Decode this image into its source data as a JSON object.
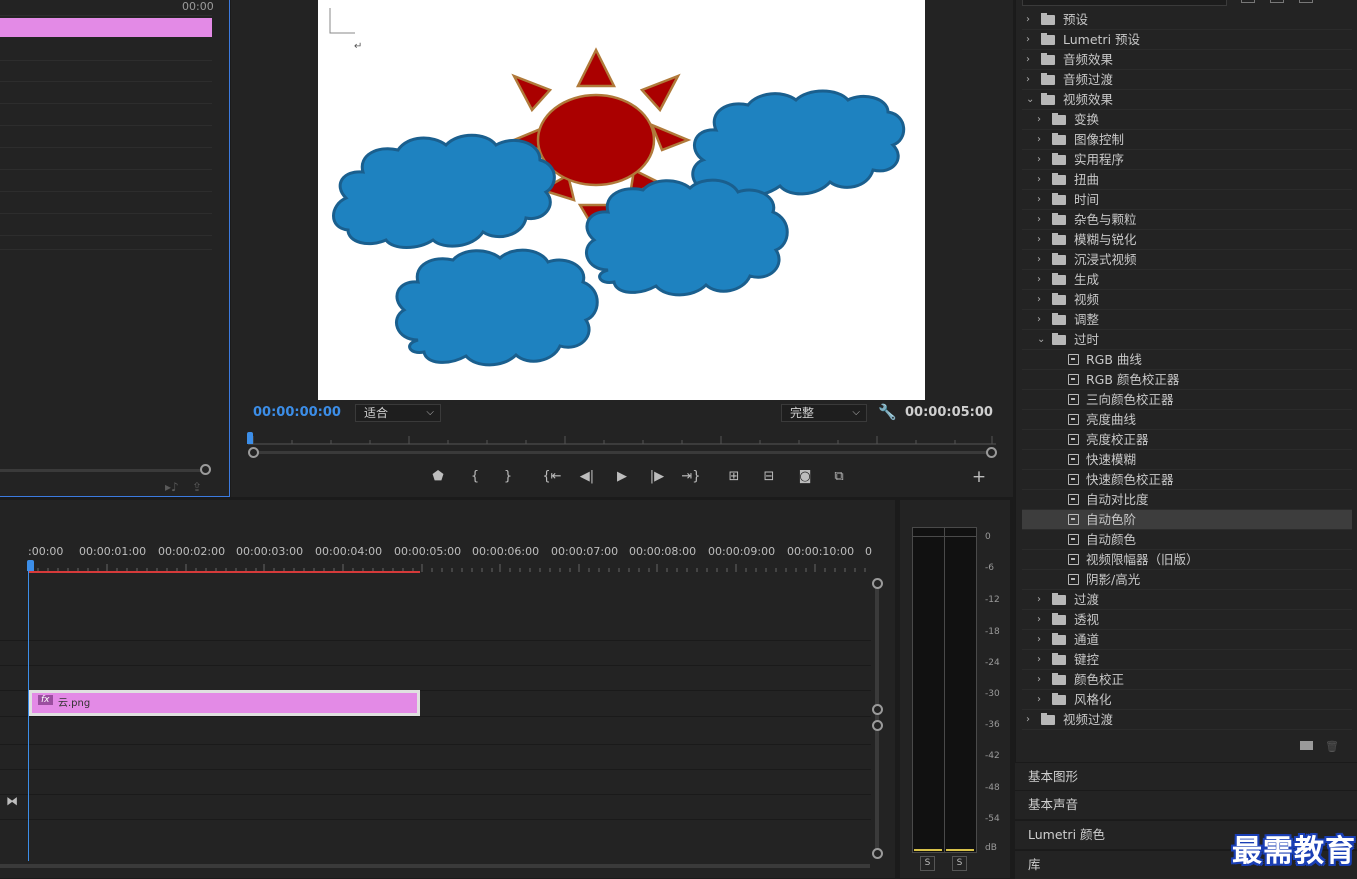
{
  "source": {
    "time": "00:00"
  },
  "program": {
    "current_time": "00:00:00:00",
    "fit": "适合",
    "quality": "完整",
    "duration": "00:00:05:00"
  },
  "transport": {
    "buttons": [
      "marker-icon",
      "mark-in-icon",
      "mark-out-icon",
      "go-to-in-icon",
      "step-back-icon",
      "play-icon",
      "step-forward-icon",
      "go-to-out-icon",
      "lift-icon",
      "extract-icon",
      "export-frame-icon",
      "comparison-view-icon",
      "add-button-icon"
    ]
  },
  "timeline": {
    "ticks": [
      ":00:00",
      "00:00:01:00",
      "00:00:02:00",
      "00:00:03:00",
      "00:00:04:00",
      "00:00:05:00",
      "00:00:06:00",
      "00:00:07:00",
      "00:00:08:00",
      "00:00:09:00",
      "00:00:10:00",
      "0"
    ],
    "clip": {
      "fx": "fx",
      "name": "云.png"
    },
    "clip_color": "#e38ae6",
    "playhead_color": "#3c8ee8"
  },
  "meter": {
    "db_labels": [
      "0",
      "-6",
      "-12",
      "-18",
      "-24",
      "-30",
      "-36",
      "-42",
      "-48",
      "-54",
      "dB"
    ],
    "solo_left": "S",
    "solo_right": "S"
  },
  "effects": {
    "rows": [
      {
        "label": "预设",
        "type": "preset-folder",
        "expanded": false,
        "level": 0
      },
      {
        "label": "Lumetri 预设",
        "type": "preset-folder",
        "expanded": false,
        "level": 0
      },
      {
        "label": "音频效果",
        "type": "folder",
        "expanded": false,
        "level": 0
      },
      {
        "label": "音频过渡",
        "type": "folder",
        "expanded": false,
        "level": 0
      },
      {
        "label": "视频效果",
        "type": "folder",
        "expanded": true,
        "level": 0
      },
      {
        "label": "变换",
        "type": "folder",
        "expanded": false,
        "level": 1
      },
      {
        "label": "图像控制",
        "type": "folder",
        "expanded": false,
        "level": 1
      },
      {
        "label": "实用程序",
        "type": "folder",
        "expanded": false,
        "level": 1
      },
      {
        "label": "扭曲",
        "type": "folder",
        "expanded": false,
        "level": 1
      },
      {
        "label": "时间",
        "type": "folder",
        "expanded": false,
        "level": 1
      },
      {
        "label": "杂色与颗粒",
        "type": "folder",
        "expanded": false,
        "level": 1
      },
      {
        "label": "模糊与锐化",
        "type": "folder",
        "expanded": false,
        "level": 1
      },
      {
        "label": "沉浸式视频",
        "type": "folder",
        "expanded": false,
        "level": 1
      },
      {
        "label": "生成",
        "type": "folder",
        "expanded": false,
        "level": 1
      },
      {
        "label": "视频",
        "type": "folder",
        "expanded": false,
        "level": 1
      },
      {
        "label": "调整",
        "type": "folder",
        "expanded": false,
        "level": 1
      },
      {
        "label": "过时",
        "type": "folder",
        "expanded": true,
        "level": 1
      },
      {
        "label": "RGB 曲线",
        "type": "effect",
        "level": 2
      },
      {
        "label": "RGB 颜色校正器",
        "type": "effect",
        "level": 2
      },
      {
        "label": "三向颜色校正器",
        "type": "effect",
        "level": 2
      },
      {
        "label": "亮度曲线",
        "type": "effect",
        "level": 2
      },
      {
        "label": "亮度校正器",
        "type": "effect",
        "level": 2
      },
      {
        "label": "快速模糊",
        "type": "effect",
        "level": 2
      },
      {
        "label": "快速颜色校正器",
        "type": "effect",
        "level": 2
      },
      {
        "label": "自动对比度",
        "type": "effect",
        "level": 2
      },
      {
        "label": "自动色阶",
        "type": "effect",
        "level": 2,
        "selected": true
      },
      {
        "label": "自动颜色",
        "type": "effect",
        "level": 2
      },
      {
        "label": "视频限幅器（旧版）",
        "type": "effect",
        "level": 2
      },
      {
        "label": "阴影/高光",
        "type": "effect",
        "level": 2
      },
      {
        "label": "过渡",
        "type": "folder",
        "expanded": false,
        "level": 1
      },
      {
        "label": "透视",
        "type": "folder",
        "expanded": false,
        "level": 1
      },
      {
        "label": "通道",
        "type": "folder",
        "expanded": false,
        "level": 1
      },
      {
        "label": "键控",
        "type": "folder",
        "expanded": false,
        "level": 1
      },
      {
        "label": "颜色校正",
        "type": "folder",
        "expanded": false,
        "level": 1
      },
      {
        "label": "风格化",
        "type": "folder",
        "expanded": false,
        "level": 1
      },
      {
        "label": "视频过渡",
        "type": "folder",
        "expanded": false,
        "level": 0
      }
    ]
  },
  "side_panels": [
    "基本图形",
    "基本声音",
    "Lumetri 颜色",
    "库"
  ],
  "watermark": "最需教育",
  "colors": {
    "sun": "#aa0000",
    "sun_outline": "#b07a3a",
    "cloud": "#1e82c0",
    "cloud_outline": "#1a5f8e",
    "accent": "#3c8ee8"
  }
}
